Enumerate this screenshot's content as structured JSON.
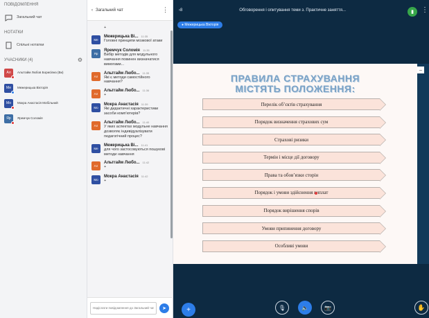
{
  "sidebar": {
    "messages_title": "ПОВІДОМЛЕННЯ",
    "public_chat": "Загальний чат",
    "notes_title": "НОТАТКИ",
    "shared_notes": "Спільні нотатки",
    "users_title": "УЧАСНИКИ (4)",
    "participants": [
      {
        "initials": "Ал",
        "name": "Альтгайм Любов Борисівна (Ви)",
        "color": "#d04848",
        "mod": false
      },
      {
        "initials": "Ме",
        "name": "Межерицька Вікторія",
        "color": "#2f4fa2",
        "mod": true
      },
      {
        "initials": "Мо",
        "name": "Мокра Анастасія Мобільний",
        "color": "#2f4fa2",
        "mod": false
      },
      {
        "initials": "Яр",
        "name": "Яремчук Соломія",
        "color": "#3d6ea5",
        "mod": false
      }
    ]
  },
  "chat": {
    "back_label": "Загальний чат",
    "input_placeholder": "Надіслати повідомлення до Загальний чат",
    "messages": [
      {
        "initials": "",
        "name": "",
        "time": "",
        "text": "+",
        "color": "#e06a2c"
      },
      {
        "initials": "Ме",
        "name": "Межерицька Ві...",
        "time": "11:35",
        "text": "Головні принципи мозкової атаки",
        "color": "#2f4fa2"
      },
      {
        "initials": "Яр",
        "name": "Яремчук Соломія",
        "time": "11:35",
        "text": "Вибір методів для модульного навчання повинен визначатися вимогами...",
        "color": "#3d6ea5"
      },
      {
        "initials": "Ал",
        "name": "Альтгайм Любо...",
        "time": "11:35",
        "text": "Які є методи самостійного навчання?",
        "color": "#e06a2c"
      },
      {
        "initials": "Ал",
        "name": "Альтгайм Любо...",
        "time": "11:36",
        "text": "+",
        "color": "#e06a2c"
      },
      {
        "initials": "Мо",
        "name": "Мокра Анастасія",
        "time": "11:39",
        "text": "Які дидактичні характеристики засоби комп'ютерів?",
        "color": "#2f4fa2"
      },
      {
        "initials": "Ал",
        "name": "Альтгайм Любо...",
        "time": "11:40",
        "text": "У яких аспектах модульне навчання дозволяє індивідуалізувати педагогічний процес?",
        "color": "#e06a2c"
      },
      {
        "initials": "Ме",
        "name": "Межерицька Ві...",
        "time": "11:41",
        "text": "для чого застосовуються пошукові методи навчання",
        "color": "#2f4fa2"
      },
      {
        "initials": "Ал",
        "name": "Альтгайм Любо...",
        "time": "11:42",
        "text": "+",
        "color": "#e06a2c"
      },
      {
        "initials": "Мо",
        "name": "Мокра Анастасія",
        "time": "11:42",
        "text": "+",
        "color": "#2f4fa2"
      }
    ]
  },
  "presentation": {
    "meeting_title": "Обговорення і опитування теми з. Практичне заняття...",
    "presenter_pill": "Межерицька Вікторія",
    "slide_title_line1": "ПРАВИЛА СТРАХУВАННЯ",
    "slide_title_line2": "МІСТЯТЬ ПОЛОЖЕННЯ:",
    "slide_items": [
      "Перелік об’єктів страхування",
      "Порядок визначення страхових сум",
      "Страхові ризики",
      "Термін і місце дії договору",
      "Права та обов’язки сторін",
      "Порядок і умови здійснення виплат",
      "Порядок вирішення спорів",
      "Умови припинення договору",
      "Особливі умови"
    ]
  },
  "icons": {
    "chat": "chat-icon",
    "notes": "notes-icon",
    "settings": "gear-icon"
  }
}
